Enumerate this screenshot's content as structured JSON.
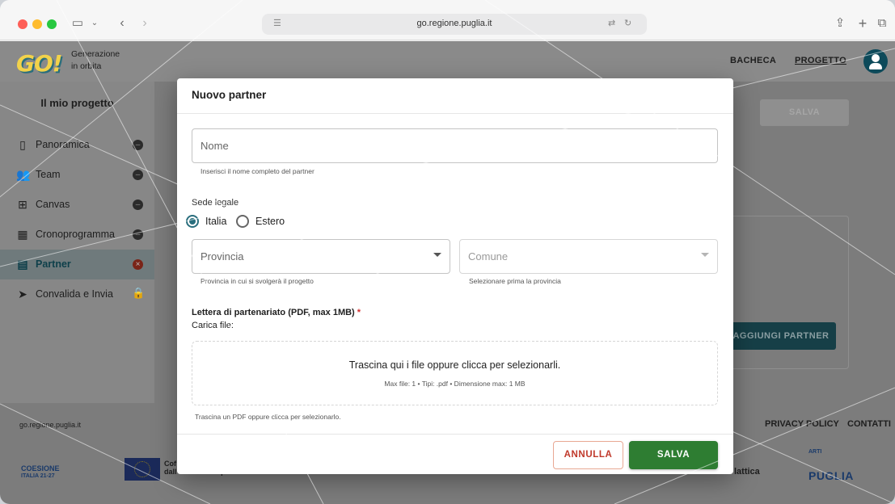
{
  "browser": {
    "url": "go.regione.puglia.it"
  },
  "header": {
    "logo_text": "GO!",
    "logo_sub_1": "Generazione",
    "logo_sub_2": "in orbita",
    "nav": [
      {
        "label": "BACHECA"
      },
      {
        "label": "PROGETTO"
      }
    ]
  },
  "sidebar": {
    "title": "Il mio progetto",
    "items": [
      {
        "label": "Panoramica",
        "icon": "clipboard-icon",
        "status": "dash"
      },
      {
        "label": "Team",
        "icon": "people-icon",
        "status": "dash"
      },
      {
        "label": "Canvas",
        "icon": "canvas-icon",
        "status": "dash"
      },
      {
        "label": "Cronoprogramma",
        "icon": "calendar-icon",
        "status": "dash"
      },
      {
        "label": "Partner",
        "icon": "building-icon",
        "status": "error"
      },
      {
        "label": "Convalida e Invia",
        "icon": "send-icon",
        "status": "locked"
      }
    ]
  },
  "background": {
    "save_label": "SALVA",
    "add_partner_label": "AGGIUNGI PARTNER"
  },
  "footer": {
    "url": "go.regione.puglia.it",
    "links": [
      {
        "label": "PRIVACY POLICY"
      },
      {
        "label": "CONTATTI"
      }
    ],
    "logos": {
      "coesione": "COESIONE",
      "coesione_sub": "ITALIA 21-27",
      "eu_1": "Cof",
      "eu_2": "dall'Unione europea",
      "lattica": "lattica",
      "arti": "ARTI",
      "puglia": "PUGLIA"
    }
  },
  "modal": {
    "title": "Nuovo partner",
    "name_field": {
      "placeholder": "Nome",
      "helper": "Inserisci il nome completo del partner"
    },
    "sede_label": "Sede legale",
    "radios": [
      {
        "label": "Italia",
        "checked": true
      },
      {
        "label": "Estero",
        "checked": false
      }
    ],
    "provincia": {
      "placeholder": "Provincia",
      "helper": "Provincia in cui si svolgerà il progetto"
    },
    "comune": {
      "placeholder": "Comune",
      "helper": "Selezionare prima la provincia"
    },
    "upload_title": "Lettera di partenariato (PDF, max 1MB)",
    "required_mark": "*",
    "upload_label": "Carica file:",
    "dropzone_main": "Trascina qui i file oppure clicca per selezionarli.",
    "dropzone_sub": "Max file: 1 • Tipi: .pdf • Dimensione max: 1 MB",
    "upload_helper": "Trascina un PDF oppure clicca per selezionarlo.",
    "cancel_label": "ANNULLA",
    "save_label": "SALVA"
  },
  "colors": {
    "primary": "#2a6e7d",
    "save_green": "#2e7d32",
    "cancel_red": "#c0392b",
    "required": "#d32f2f"
  }
}
